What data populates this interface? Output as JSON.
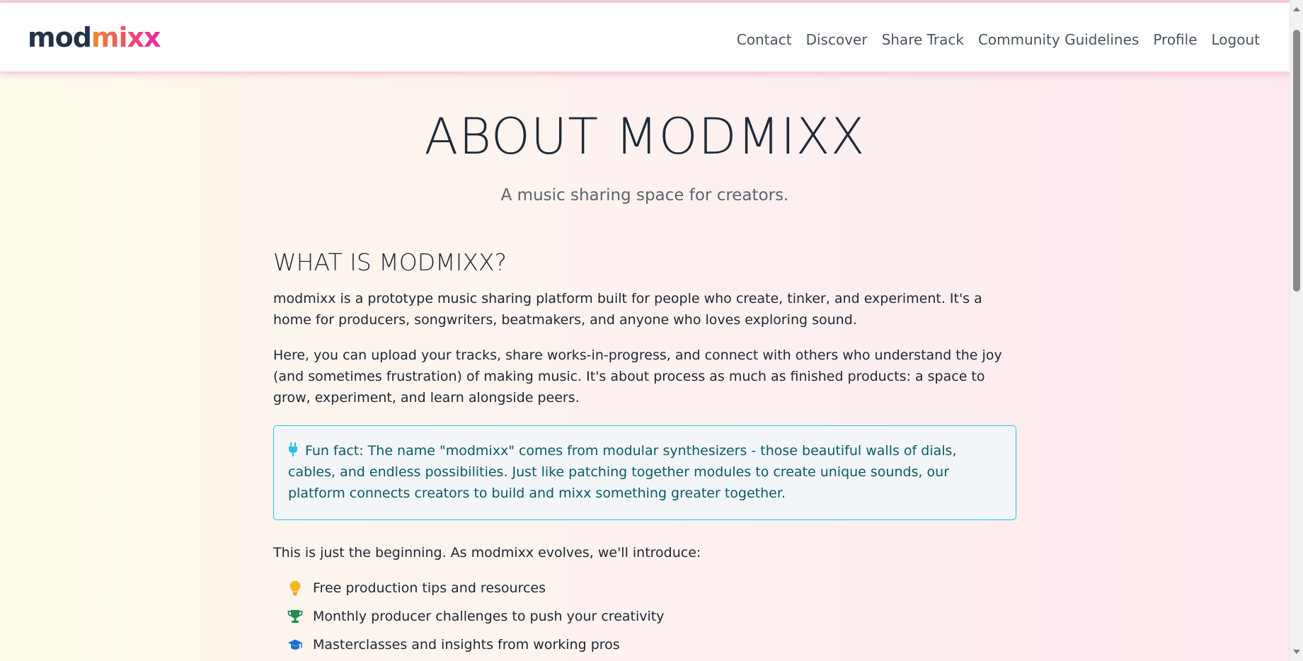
{
  "brand": {
    "part1": "mod",
    "part2": "mixx"
  },
  "nav": {
    "items": [
      {
        "label": "Contact"
      },
      {
        "label": "Discover"
      },
      {
        "label": "Share Track"
      },
      {
        "label": "Community Guidelines"
      },
      {
        "label": "Profile"
      },
      {
        "label": "Logout"
      }
    ]
  },
  "hero": {
    "title": "ABOUT MODMIXX",
    "subtitle": "A music sharing space for creators."
  },
  "about": {
    "heading": "WHAT IS MODMIXX?",
    "paragraph1": "modmixx is a prototype music sharing platform built for people who create, tinker, and experiment. It's a home for producers, songwriters, beatmakers, and anyone who loves exploring sound.",
    "paragraph2": "Here, you can upload your tracks, share works-in-progress, and connect with others who understand the joy (and sometimes frustration) of making music. It's about process as much as finished products: a space to grow, experiment, and learn alongside peers.",
    "fun_fact": "Fun fact: The name \"modmixx\" comes from modular synthesizers - those beautiful walls of dials, cables, and endless possibilities. Just like patching together modules to create unique sounds, our platform connects creators to build and mixx something greater together.",
    "intro": "This is just the beginning. As modmixx evolves, we'll introduce:",
    "features": [
      {
        "icon": "lightbulb-icon",
        "label": "Free production tips and resources"
      },
      {
        "icon": "trophy-icon",
        "label": "Monthly producer challenges to push your creativity"
      },
      {
        "icon": "graduation-cap-icon",
        "label": "Masterclasses and insights from working pros"
      }
    ]
  },
  "colors": {
    "accent_cyan": "#27c3e0",
    "fun_fact_text": "#0a5a66",
    "brand_dark": "#233245",
    "brand_gradient_start": "#f08a2c",
    "brand_gradient_end": "#e02da5"
  }
}
